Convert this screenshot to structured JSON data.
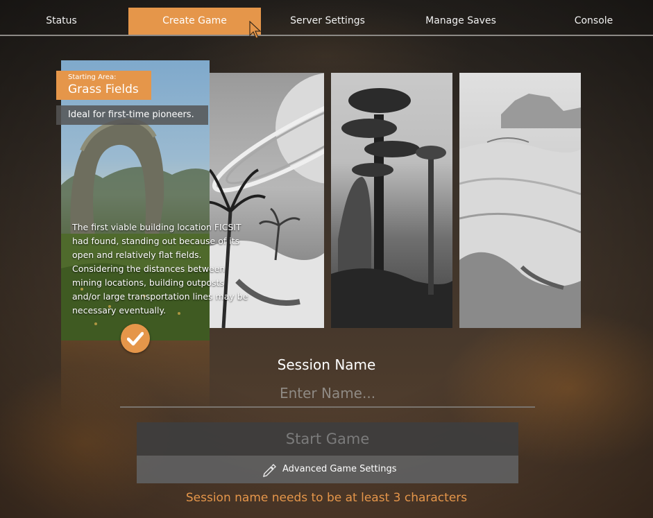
{
  "nav": {
    "tabs": [
      {
        "label": "Status",
        "active": false
      },
      {
        "label": "Create Game",
        "active": true
      },
      {
        "label": "Server Settings",
        "active": false
      },
      {
        "label": "Manage Saves",
        "active": false
      },
      {
        "label": "Console",
        "active": false
      }
    ]
  },
  "starting_area": {
    "caption": "Starting Area:",
    "name": "Grass Fields",
    "tagline": "Ideal for first-time pioneers.",
    "description": "The first viable building location FICSIT had found, standing out because of its open and relatively flat fields. Considering the distances between mining locations, building outposts and/or large transportation lines may be necessary eventually."
  },
  "session": {
    "label": "Session Name",
    "placeholder": "Enter Name...",
    "value": ""
  },
  "buttons": {
    "start_game": "Start Game",
    "advanced_settings": "Advanced Game Settings"
  },
  "error": "Session name needs to be at least 3 characters",
  "colors": {
    "accent": "#e5964a",
    "disabled_button": "#3e3e3e",
    "secondary_button": "#5f5f5f"
  }
}
